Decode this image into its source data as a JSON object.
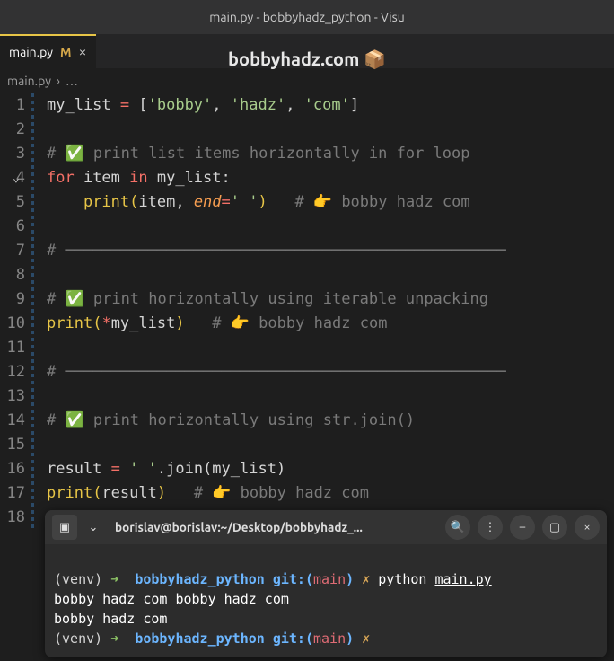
{
  "window": {
    "title": "main.py - bobbyhadz_python - Visu"
  },
  "tab": {
    "filename": "main.py",
    "modified": "M"
  },
  "watermark": {
    "text": "bobbyhadz.com 📦"
  },
  "breadcrumb": {
    "file": "main.py",
    "sep": "›",
    "more": "…"
  },
  "code": {
    "l1_a": "my_list ",
    "l1_b": "=",
    "l1_c": " [",
    "l1_d": "'bobby'",
    "l1_e": ", ",
    "l1_f": "'hadz'",
    "l1_g": ", ",
    "l1_h": "'com'",
    "l1_i": "]",
    "l3": "# ✅ print list items horizontally in for loop",
    "l4_a": "for",
    "l4_b": " item ",
    "l4_c": "in",
    "l4_d": " my_list:",
    "l5_a": "print",
    "l5_b": "(",
    "l5_c": "item, ",
    "l5_d": "end",
    "l5_e": "=",
    "l5_f": "' '",
    "l5_g": ")",
    "l5_h": "   # 👉 bobby hadz com",
    "l7": "# ────────────────────────────────────────────────",
    "l9": "# ✅ print horizontally using iterable unpacking",
    "l10_a": "print",
    "l10_b": "(",
    "l10_c": "*",
    "l10_d": "my_list",
    "l10_e": ")",
    "l10_f": "   # 👉 bobby hadz com",
    "l12": "# ────────────────────────────────────────────────",
    "l14": "# ✅ print horizontally using str.join()",
    "l16_a": "result ",
    "l16_b": "=",
    "l16_c": " ",
    "l16_d": "' '",
    "l16_e": ".join(",
    "l16_f": "my_list",
    "l16_g": ")",
    "l17_a": "print",
    "l17_b": "(",
    "l17_c": "result",
    "l17_d": ")",
    "l17_e": "   # 👉 bobby hadz com"
  },
  "ln": {
    "1": "1",
    "2": "2",
    "3": "3",
    "4": "4",
    "5": "5",
    "6": "6",
    "7": "7",
    "8": "8",
    "9": "9",
    "10": "10",
    "11": "11",
    "12": "12",
    "13": "13",
    "14": "14",
    "15": "15",
    "16": "16",
    "17": "17",
    "18": "18"
  },
  "terminal": {
    "title": "borislav@borislav:~/Desktop/bobbyhadz_...",
    "l1_a": "(venv) ",
    "l1_b": "➜  ",
    "l1_c": "bobbyhadz_python ",
    "l1_d": "git:(",
    "l1_e": "main",
    "l1_f": ") ",
    "l1_g": "✗ ",
    "l1_h": "python ",
    "l1_i": "main.py",
    "l2": "bobby hadz com bobby hadz com",
    "l3": "bobby hadz com",
    "l4_a": "(venv) ",
    "l4_b": "➜  ",
    "l4_c": "bobbyhadz_python ",
    "l4_d": "git:(",
    "l4_e": "main",
    "l4_f": ") ",
    "l4_g": "✗"
  }
}
